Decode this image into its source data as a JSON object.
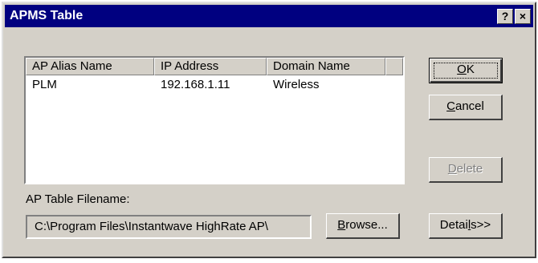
{
  "window": {
    "title": "APMS Table",
    "help_glyph": "?",
    "close_glyph": "×"
  },
  "list": {
    "columns": [
      "AP Alias Name",
      "IP Address",
      "Domain Name",
      ""
    ],
    "rows": [
      {
        "alias": "PLM",
        "ip": "192.168.1.11",
        "domain": "Wireless"
      }
    ]
  },
  "buttons": {
    "ok": {
      "accel": "O",
      "rest": "K"
    },
    "cancel": {
      "accel": "C",
      "rest": "ancel"
    },
    "delete": {
      "accel": "D",
      "rest": "elete"
    },
    "browse": {
      "accel": "B",
      "rest": "rowse..."
    },
    "details": {
      "pre": "Detai",
      "accel": "l",
      "rest": "s>>"
    }
  },
  "filename": {
    "label": "AP Table Filename:",
    "value": "C:\\Program Files\\Instantwave HighRate AP\\"
  },
  "icons": {
    "help": "help-icon",
    "close": "close-icon"
  },
  "colors": {
    "face": "#d4d0c8",
    "titlebar": "#000080",
    "disabled_text": "#808080"
  }
}
